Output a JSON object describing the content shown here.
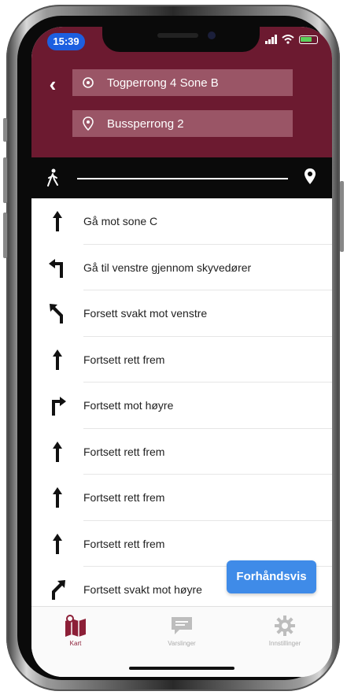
{
  "status_bar": {
    "time": "15:39"
  },
  "header": {
    "back_label": "‹",
    "from": "Togperrong 4 Sone B",
    "to": "Bussperrong 2",
    "color": "#6c1a30"
  },
  "directions": [
    {
      "icon": "arrow-straight-icon",
      "text": "Gå mot sone C"
    },
    {
      "icon": "arrow-turn-left-icon",
      "text": "Gå til venstre gjennom skyvedører"
    },
    {
      "icon": "arrow-slight-left-icon",
      "text": "Forsett svakt mot venstre"
    },
    {
      "icon": "arrow-straight-icon",
      "text": "Fortsett rett frem"
    },
    {
      "icon": "arrow-turn-right-icon",
      "text": "Fortsett mot høyre"
    },
    {
      "icon": "arrow-straight-icon",
      "text": "Fortsett rett frem"
    },
    {
      "icon": "arrow-straight-icon",
      "text": "Fortsett rett frem"
    },
    {
      "icon": "arrow-straight-icon",
      "text": "Fortsett rett frem"
    },
    {
      "icon": "arrow-slight-right-icon",
      "text": "Fortsett svakt mot høyre"
    }
  ],
  "preview_button": {
    "label": "Forhåndsvis",
    "color": "#3f8be8"
  },
  "tabbar": {
    "tabs": [
      {
        "label": "Kart",
        "icon": "map-icon",
        "active": true
      },
      {
        "label": "Varslinger",
        "icon": "message-icon",
        "active": false
      },
      {
        "label": "Innstillinger",
        "icon": "gear-icon",
        "active": false
      }
    ],
    "active_color": "#8c1f37"
  }
}
